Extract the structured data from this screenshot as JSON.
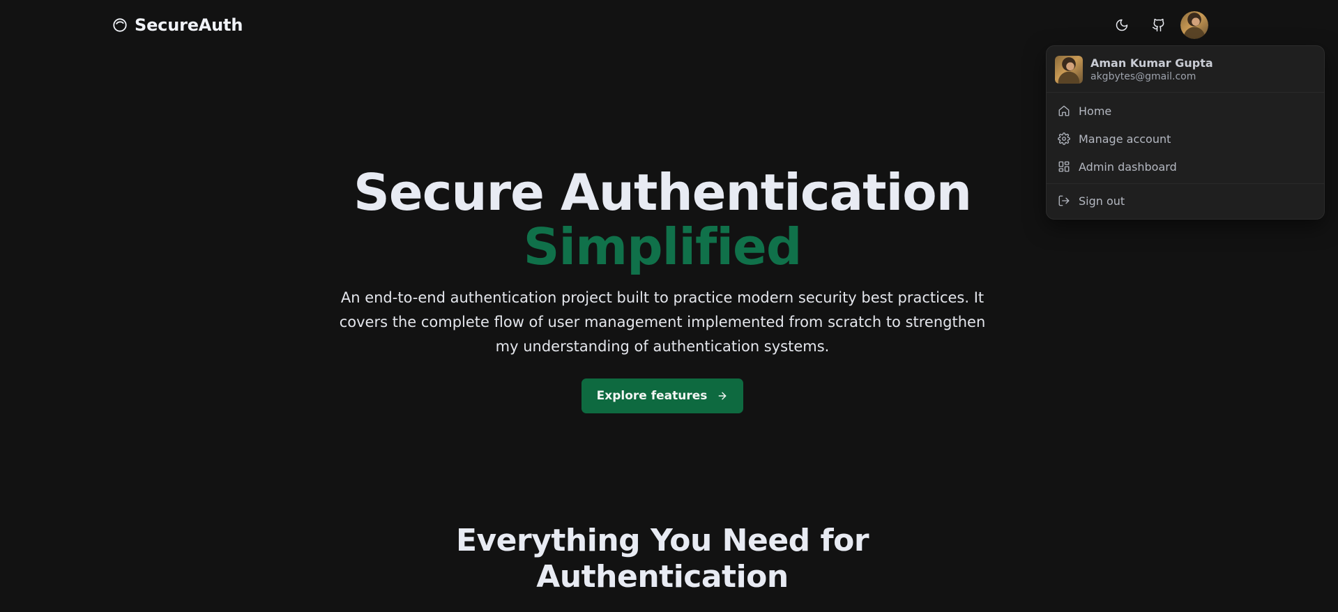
{
  "header": {
    "brand_name": "SecureAuth",
    "icons": [
      "logo-icon",
      "moon-icon",
      "github-icon",
      "avatar"
    ]
  },
  "dropdown": {
    "user_name": "Aman Kumar Gupta",
    "user_email": "akgbytes@gmail.com",
    "items": [
      {
        "label": "Home",
        "icon": "home-icon"
      },
      {
        "label": "Manage account",
        "icon": "gear-icon"
      },
      {
        "label": "Admin dashboard",
        "icon": "dashboard-icon"
      },
      {
        "label": "Sign out",
        "icon": "sign-out-icon"
      }
    ]
  },
  "hero": {
    "title": "Secure Authentication",
    "accent": "Simplified",
    "description": "An end-to-end authentication project built to practice modern security best practices. It covers the complete flow of user management implemented from scratch to strengthen my understanding of authentication systems.",
    "cta_label": "Explore features"
  },
  "features": {
    "title_line1": "Everything You Need for",
    "title_line2": "Authentication"
  },
  "colors": {
    "background": "#121212",
    "accent": "#10714a",
    "button": "#0e6a40"
  }
}
